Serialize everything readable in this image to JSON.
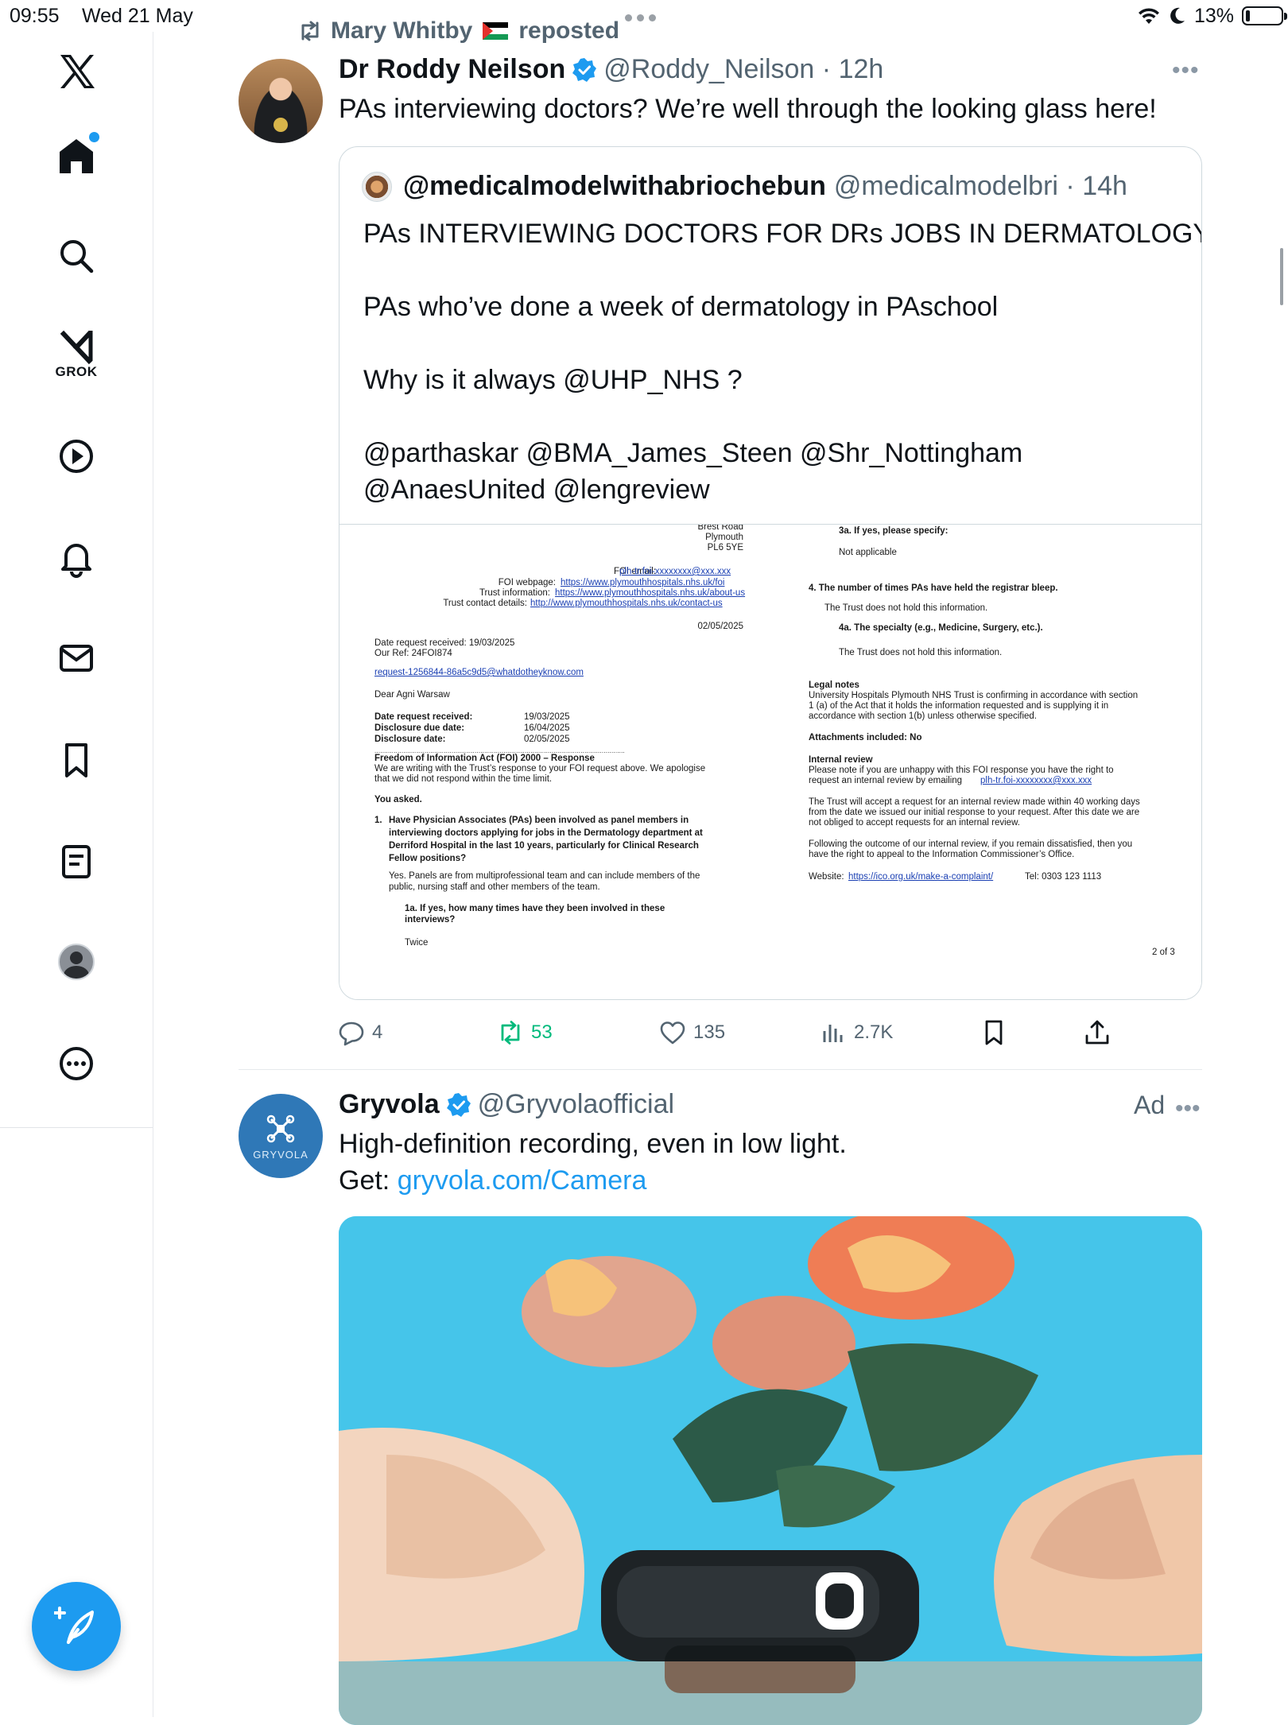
{
  "status_bar": {
    "time": "09:55",
    "date": "Wed 21 May",
    "battery": "13%",
    "battery_level": 0.13
  },
  "sidebar": {
    "items": [
      {
        "name": "x-logo",
        "label": ""
      },
      {
        "name": "home",
        "label": ""
      },
      {
        "name": "search",
        "label": ""
      },
      {
        "name": "grok",
        "label": "GROK"
      },
      {
        "name": "videos",
        "label": ""
      },
      {
        "name": "notifications",
        "label": ""
      },
      {
        "name": "messages",
        "label": ""
      },
      {
        "name": "bookmarks",
        "label": ""
      },
      {
        "name": "lists",
        "label": ""
      },
      {
        "name": "profile",
        "label": ""
      },
      {
        "name": "more",
        "label": ""
      }
    ],
    "accent_color": "#1d9bf0"
  },
  "feed": {
    "repost": {
      "reposter": "Mary Whitby",
      "action": "reposted"
    },
    "tweet": {
      "author_name": "Dr Roddy Neilson",
      "handle": "@Roddy_Neilson",
      "time": "12h",
      "text": "PAs interviewing doctors? We’re well through the looking glass here!",
      "quote": {
        "author_name": "@medicalmodelwithabriochebun",
        "handle": "@medicalmodelbri",
        "time": "14h",
        "lines": [
          "PAs INTERVIEWING DOCTORS FOR DRs JOBS IN DERMATOLOGY !",
          "PAs who’ve done a week of dermatology in PAschool",
          "Why is it always @UHP_NHS ?",
          "@parthaskar @BMA_James_Steen @Shr_Nottingham",
          "@AnaesUnited @lengreview"
        ],
        "document": {
          "left": {
            "addr1": "Brest Road",
            "addr2": "Plymouth",
            "addr3": "PL6 5YE",
            "foi_email_label": "FOI email:",
            "foi_email": "plh-tr.foi-xxxxxxxx@xxx.xxx",
            "foi_web_label": "FOI webpage:",
            "foi_web": "https://www.plymouthhospitals.nhs.uk/foi",
            "trust_info_label": "Trust information:",
            "trust_info": "https://www.plymouthhospitals.nhs.uk/about-us",
            "trust_contact_label": "Trust contact details:",
            "trust_contact": "http://www.plymouthhospitals.nhs.uk/contact-us",
            "doc_date": "02/05/2025",
            "date_received_line": "Date request received: 19/03/2025",
            "our_ref": "Our Ref: 24FOI874",
            "request_email": "request-1256844-86a5c9d5@whatdotheyknow.com",
            "dear": "Dear Agni Warsaw",
            "dates": [
              {
                "label": "Date request received:",
                "value": "19/03/2025"
              },
              {
                "label": "Disclosure due date:",
                "value": "16/04/2025"
              },
              {
                "label": "Disclosure date:",
                "value": "02/05/2025"
              }
            ],
            "dotted": "..................................................................................................................................",
            "foi_heading": "Freedom of Information Act (FOI) 2000 – Response",
            "foi_para_1": "We are writing with the Trust’s response to your FOI request above. We apologise",
            "foi_para_2": "that we did not respond within the time limit.",
            "you_asked": "You asked.",
            "q1_num": "1.",
            "q1_lines": [
              "Have Physician Associates (PAs) been involved as panel members in",
              "interviewing doctors applying for jobs in the Dermatology department at",
              "Derriford Hospital in the last 10 years, particularly for Clinical Research",
              "Fellow positions?"
            ],
            "a1_lines": [
              "Yes. Panels are from multiprofessional team and can include members of the",
              "public, nursing staff and other members of the team."
            ],
            "q1a_lines": [
              "1a. If yes, how many times have they been involved in these",
              "interviews?"
            ],
            "a1a": "Twice"
          },
          "right": {
            "q3a": "3a. If yes, please specify:",
            "a3a": "Not applicable",
            "q4": "4.   The number of times PAs have held the registrar bleep.",
            "a4": "The Trust does not hold this information.",
            "q4a": "4a. The specialty (e.g., Medicine, Surgery, etc.).",
            "a4a": "The Trust does not hold this information.",
            "legal_heading": "Legal notes",
            "legal_lines": [
              "University Hospitals Plymouth NHS Trust is confirming in accordance with section",
              "1 (a) of the Act that it holds the information requested and is supplying it in",
              "accordance with section 1(b) unless otherwise specified."
            ],
            "attachments": "Attachments included: No",
            "internal_heading": "Internal review",
            "internal_line_1": "Please note if you are unhappy with this FOI response you have the right to",
            "internal_line_2_prefix": "request an internal review by emailing",
            "internal_email": "plh-tr.foi-xxxxxxxx@xxx.xxx",
            "review_lines": [
              "The Trust will accept a request for an internal review made within 40 working days",
              "from the date we issued our initial response to your request. After this date we are",
              "not obliged to accept requests for an internal review."
            ],
            "following_lines": [
              "Following the outcome of our internal review, if you remain dissatisfied, then you",
              "have the right to appeal to the Information Commissioner’s Office."
            ],
            "website_label": "Website:",
            "website": "https://ico.org.uk/make-a-complaint/",
            "tel": "Tel: 0303 123 1113",
            "page": "2 of 3"
          }
        }
      },
      "stats": {
        "replies": "4",
        "reposts": "53",
        "likes": "135",
        "views": "2.7K"
      }
    },
    "ad": {
      "author_name": "Gryvola",
      "handle": "@Gryvolaofficial",
      "tag": "Ad",
      "logo_text": "GRYVOLA",
      "text": "High-definition recording, even in low light.",
      "get_label": "Get:",
      "link": "gryvola.com/Camera"
    }
  },
  "colors": {
    "text": "#0f1419",
    "muted": "#536471",
    "link": "#1d9bf0",
    "repost_green": "#00ba7c",
    "verified": "#1d9bf0",
    "border": "#cfd9de"
  }
}
